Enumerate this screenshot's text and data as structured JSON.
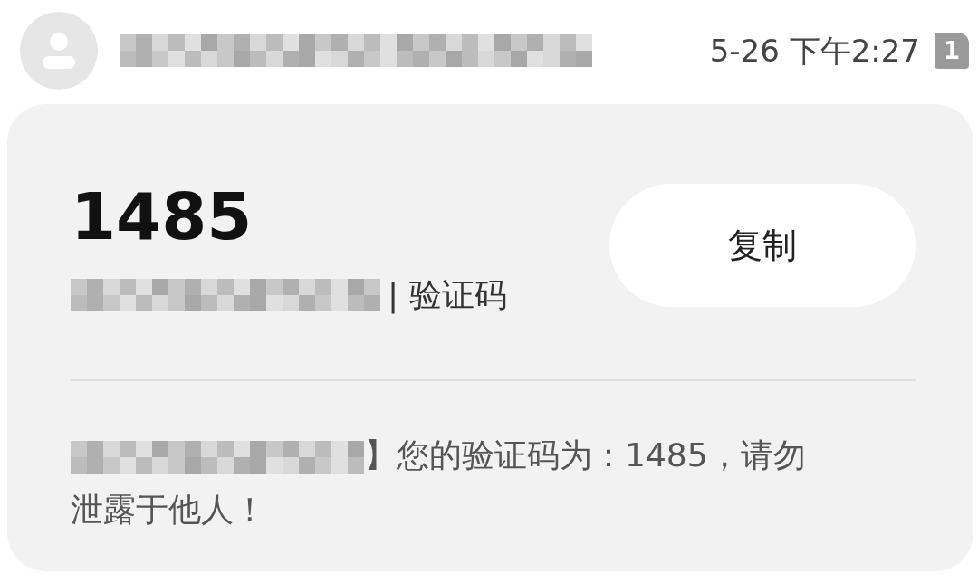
{
  "header": {
    "contact": {
      "redacted": true
    },
    "time": "5-26 下午2:27",
    "sim": "1"
  },
  "card": {
    "code": "1485",
    "sender": {
      "redacted": true
    },
    "sender_suffix": "| 验证码",
    "copy_button": "复制",
    "message": {
      "redacted_prefix": true,
      "line_1": "】您的验证码为：1485，请勿",
      "line_2": "泄露于他人！"
    }
  }
}
